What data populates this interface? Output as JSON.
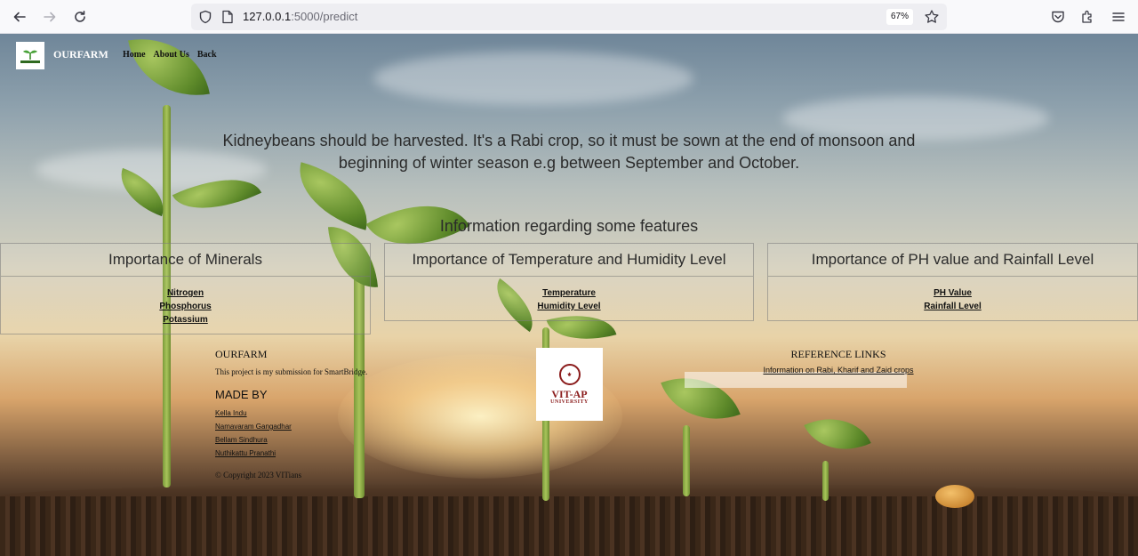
{
  "browser": {
    "url_host": "127.0.0.1",
    "url_rest": ":5000/predict",
    "zoom": "67%"
  },
  "site": {
    "brand": "OURFARM",
    "nav": [
      "Home",
      "About Us",
      "Back"
    ]
  },
  "prediction": {
    "text": "Kidneybeans should be harvested. It's a Rabi crop, so it must be sown at the end of monsoon and beginning of winter season e.g between September and October."
  },
  "features": {
    "title": "Information regarding some features",
    "cards": [
      {
        "title": "Importance of Minerals",
        "links": [
          "Nitrogen",
          "Phosphorus",
          "Potassium"
        ]
      },
      {
        "title": "Importance of Temperature and Humidity Level",
        "links": [
          "Temperature",
          "Humidity Level"
        ]
      },
      {
        "title": "Importance of PH value and Rainfall Level",
        "links": [
          "PH Value",
          "Rainfall Level"
        ]
      }
    ]
  },
  "footer": {
    "brand": "OURFARM",
    "description": "This project is my submission for SmartBridge.",
    "made_by": "MADE BY",
    "members": [
      "Kella Indu",
      "Namavaram Gangadhar",
      "Bellam Sindhura",
      "Nuthikattu Pranathi"
    ],
    "copyright": "© Copyright 2023 VITians",
    "university_name": "VIT-AP",
    "university_sub": "UNIVERSITY",
    "references_title": "REFERENCE LINKS",
    "references_link": "Information on Rabi, Kharif and Zaid crops"
  }
}
